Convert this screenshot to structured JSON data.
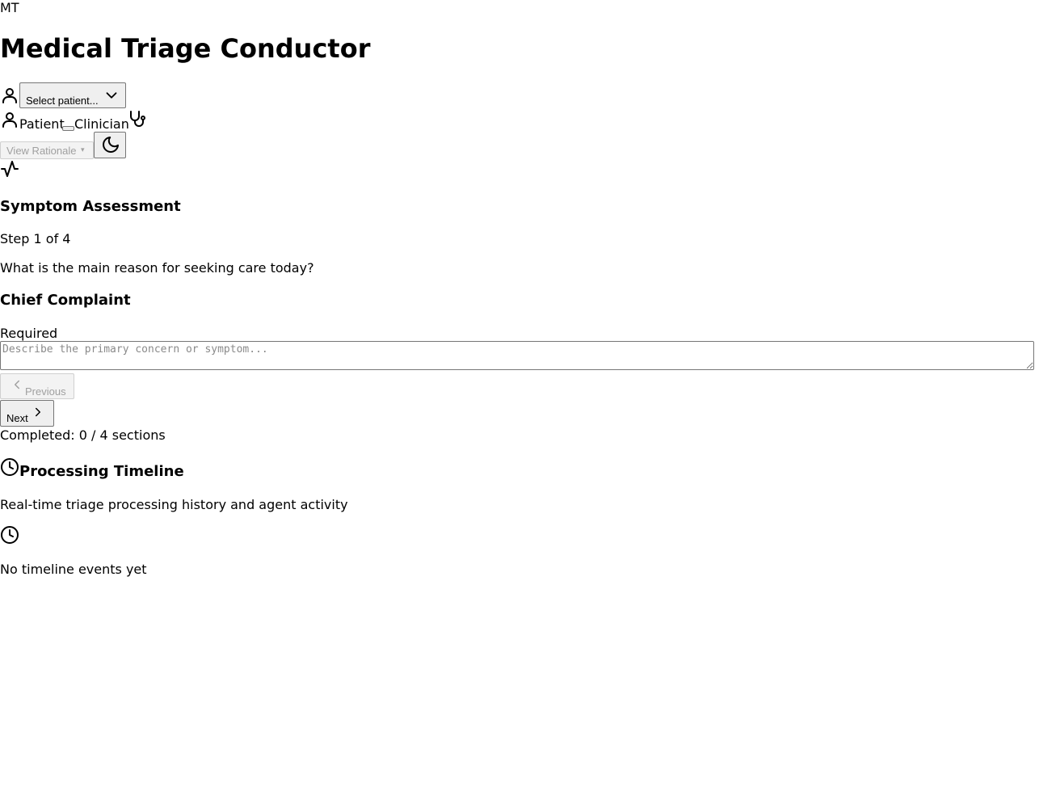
{
  "header": {
    "logo_initials": "MT",
    "title": "Medical Triage Conductor"
  },
  "patient_select": {
    "selected_label": "Select patient..."
  },
  "mode_toggle": {
    "patient_label": "Patient",
    "clinician_label": "Clinician"
  },
  "toolbar": {
    "view_rationale_label": "View Rationale",
    "view_rationale_caret": "▾"
  },
  "assessment": {
    "title": "Symptom Assessment",
    "step_text": "Step 1 of 4",
    "question": "What is the main reason for seeking care today?",
    "field_label": "Chief Complaint",
    "required_text": "Required",
    "field_placeholder": "Describe the primary concern or symptom...",
    "field_value": "",
    "previous_label": "Previous",
    "next_label": "Next",
    "completed_text": "Completed: 0 / 4 sections"
  },
  "timeline": {
    "title": "Processing Timeline",
    "subtitle": "Real-time triage processing history and agent activity",
    "empty_text": "No timeline events yet"
  },
  "icons": {
    "user": "user-icon",
    "chevron_down": "chevron-down-icon",
    "stethoscope": "stethoscope-icon",
    "moon": "moon-icon",
    "activity": "activity-icon",
    "clock": "clock-icon",
    "chevron_left": "chevron-left-icon",
    "chevron_right": "chevron-right-icon"
  }
}
